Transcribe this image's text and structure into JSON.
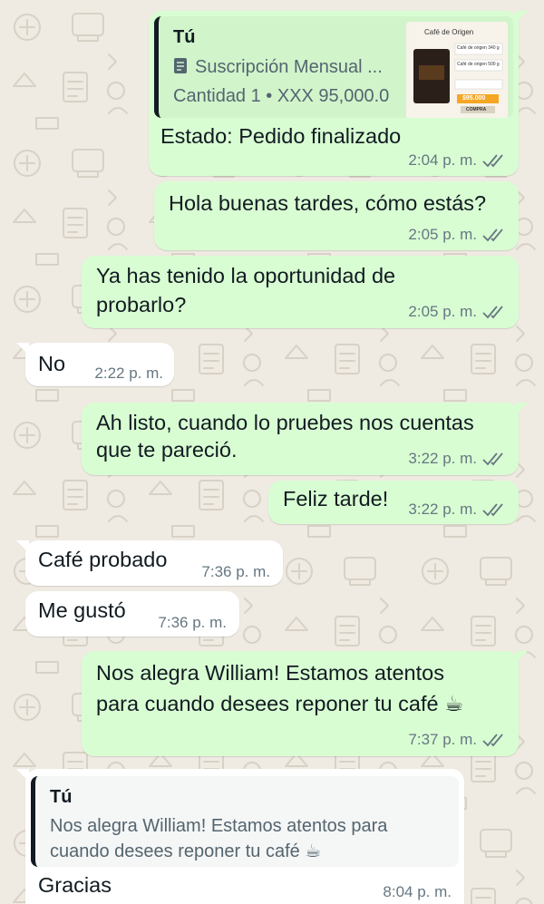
{
  "colors": {
    "outgoing_bubble": "#d9fdd3",
    "incoming_bubble": "#ffffff",
    "background": "#efeae2",
    "read_ticks": "#667781"
  },
  "messages": [
    {
      "quote": {
        "author": "Tú",
        "product_title": "Suscripción Mensual ...",
        "quantity": "Cantidad 1 • XXX 95,000.0",
        "icon": "document-icon",
        "thumbnail_text": {
          "heading": "Café de Origen",
          "line1": "Café de origen 340 g",
          "line2": "Café de origen 500 g",
          "price": "$95.000",
          "button": "COMPRA"
        }
      },
      "text": "Estado: Pedido finalizado",
      "time": "2:04 p. m."
    },
    {
      "text": "Hola buenas tardes, cómo estás?",
      "time": "2:05 p. m."
    },
    {
      "text_lines": [
        "Ya has tenido la oportunidad de",
        "probarlo?"
      ],
      "time": "2:05 p. m."
    },
    {
      "text": "No",
      "time": "2:22 p. m."
    },
    {
      "text_lines": [
        "Ah listo, cuando lo pruebes nos cuentas",
        "que te pareció."
      ],
      "time": "3:22 p. m."
    },
    {
      "text": "Feliz tarde!",
      "time": "3:22 p. m."
    },
    {
      "text": "Café probado",
      "time": "7:36 p. m."
    },
    {
      "text": "Me gustó",
      "time": "7:36 p. m."
    },
    {
      "text_lines": [
        "Nos alegra William! Estamos atentos",
        "para cuando desees reponer tu café ☕"
      ],
      "time": "7:37 p. m."
    },
    {
      "quote": {
        "author": "Tú",
        "lines": [
          "Nos alegra William! Estamos atentos para",
          "cuando desees reponer tu café ☕"
        ]
      },
      "text": "Gracias",
      "time": "8:04 p. m."
    }
  ]
}
